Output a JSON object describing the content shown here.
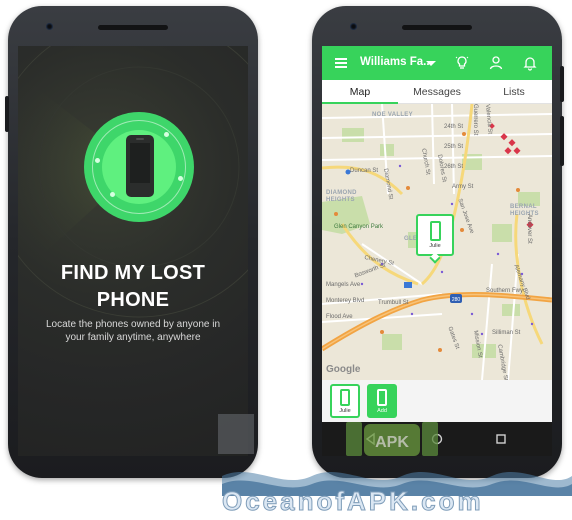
{
  "left_phone": {
    "headline_line1": "FIND MY LOST",
    "headline_line2": "PHONE",
    "subtitle": "Locate the phones owned by anyone in your family anytime, anywhere",
    "accent_color": "#3ed66a",
    "icon": "smartphone-icon"
  },
  "right_phone": {
    "appbar": {
      "title": "Williams Fa...",
      "icons": [
        "menu-icon",
        "chevron-down-icon",
        "lightbulb-icon",
        "person-icon",
        "bell-icon"
      ],
      "color": "#37d35b"
    },
    "tabs": [
      {
        "label": "Map",
        "active": true
      },
      {
        "label": "Messages",
        "active": false
      },
      {
        "label": "Lists",
        "active": false
      }
    ],
    "map": {
      "neighborhoods": [
        "NOE VALLEY",
        "DIAMOND HEIGHTS",
        "GLEN PARK",
        "BERNAL HEIGHTS"
      ],
      "streets": [
        "24th St",
        "25th St",
        "26th St",
        "Duncan St",
        "Army St",
        "Diamond St",
        "Church St",
        "Dolores St",
        "Guerrero St",
        "Valencia St",
        "Chenery St",
        "Bosworth St",
        "Mangels Ave",
        "Monterey Blvd",
        "Flood Ave",
        "Southern Fwy",
        "Andover St",
        "Gates St",
        "Silliman St",
        "Cambridge St",
        "Trumbull St",
        "Alemany Blvd",
        "Glen Canyon Park",
        "San Jose Ave",
        "Mission St"
      ],
      "highway_shield": "280",
      "attribution": "Google",
      "pin": {
        "label": "Julie",
        "icon": "smartphone-icon"
      }
    },
    "devices": [
      {
        "label": "Julie",
        "icon": "smartphone-icon"
      },
      {
        "label": "Add",
        "icon": "smartphone-icon"
      }
    ],
    "navbar": [
      "back-icon",
      "home-icon",
      "recents-icon"
    ]
  },
  "watermark": {
    "logo_text": "APK",
    "text": "OceanofAPK.com"
  }
}
